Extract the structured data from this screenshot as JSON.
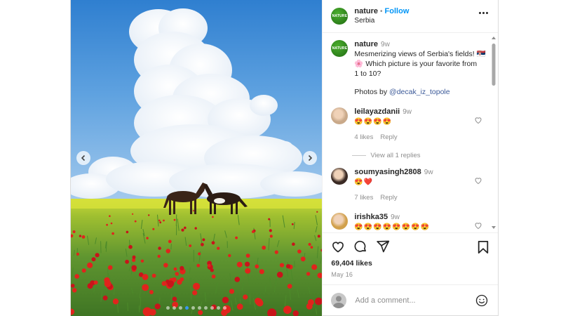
{
  "post": {
    "username": "nature",
    "follow_label": "Follow",
    "location": "Serbia",
    "logo_text": "NATURE",
    "separator": "•"
  },
  "caption": {
    "username": "nature",
    "time": "9w",
    "text_line1": "Mesmerizing views of Serbia's fields! 🇷🇸",
    "text_line2": "🌸  Which picture is your favorite from",
    "text_line3": "1 to 10?",
    "photos_by": "Photos by ",
    "mention": "@decak_iz_topole"
  },
  "comments": [
    {
      "username": "leilayazdanii",
      "time": "9w",
      "emojis": "😍😍😍😍",
      "likes": "4 likes",
      "reply": "Reply",
      "view_replies": "View all 1 replies",
      "avatar_color": "#c9a98a"
    },
    {
      "username": "soumyasingh2808",
      "time": "9w",
      "emojis": "😍❤️",
      "likes": "7 likes",
      "reply": "Reply",
      "avatar_color": "#3a2a24"
    },
    {
      "username": "irishka35",
      "time": "9w",
      "emojis": "😍😍😍😍😍😍😍😍",
      "avatar_color": "#d1a04b"
    }
  ],
  "stats": {
    "likes": "69,404 likes",
    "date": "May 16"
  },
  "composer": {
    "placeholder": "Add a comment..."
  },
  "carousel": {
    "slide_count": 10,
    "active_slide": 4
  },
  "colors": {
    "follow": "#0095f6",
    "mention": "#3b5998",
    "active_dot": "#3897f0",
    "text": "#262626",
    "muted": "#8e8e8e"
  },
  "icons": [
    "chevron-left-icon",
    "chevron-right-icon",
    "more-icon",
    "heart-icon",
    "comment-icon",
    "share-icon",
    "bookmark-icon",
    "smiley-icon"
  ]
}
